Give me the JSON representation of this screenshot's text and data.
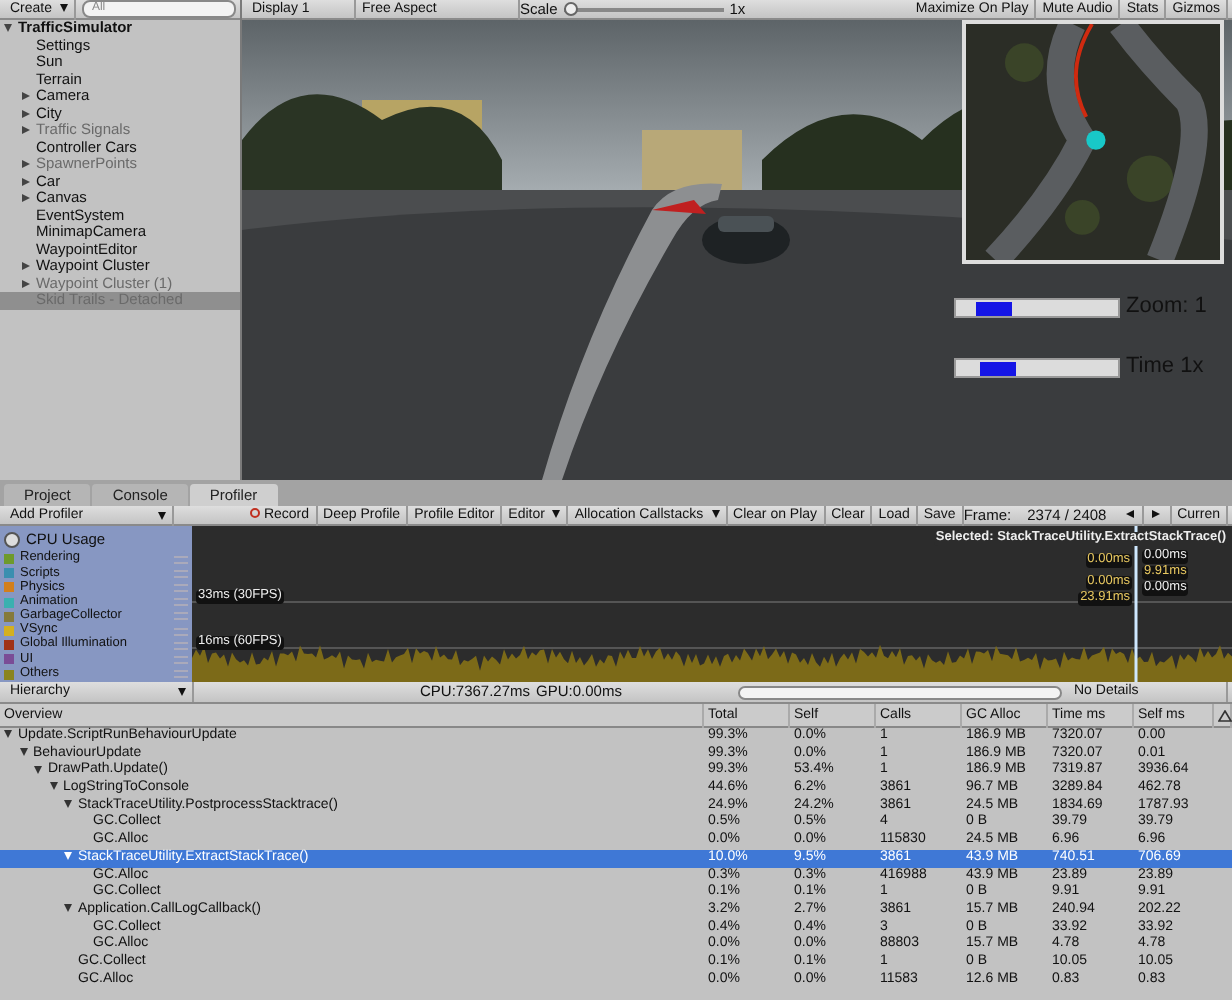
{
  "hierarchy_panel": {
    "create_button": "Create",
    "search": {
      "placeholder": "All"
    },
    "root": {
      "label": "TrafficSimulator",
      "expanded": true,
      "selected": false,
      "disabled": false,
      "children": [
        {
          "label": "Settings",
          "kind": "leaf",
          "selected": false,
          "disabled": false
        },
        {
          "label": "Sun",
          "kind": "leaf",
          "selected": false,
          "disabled": false
        },
        {
          "label": "Terrain",
          "kind": "leaf",
          "selected": false,
          "disabled": false
        },
        {
          "label": "Camera",
          "kind": "group",
          "expanded": false,
          "selected": false,
          "disabled": false
        },
        {
          "label": "City",
          "kind": "group",
          "expanded": false,
          "selected": false,
          "disabled": false
        },
        {
          "label": "Traffic Signals",
          "kind": "group",
          "expanded": false,
          "selected": false,
          "disabled": true
        },
        {
          "label": "Controller Cars",
          "kind": "leaf",
          "selected": false,
          "disabled": false
        },
        {
          "label": "SpawnerPoints",
          "kind": "group",
          "expanded": false,
          "selected": false,
          "disabled": true
        },
        {
          "label": "Car",
          "kind": "group",
          "expanded": false,
          "selected": false,
          "disabled": false
        },
        {
          "label": "Canvas",
          "kind": "group",
          "expanded": false,
          "selected": false,
          "disabled": false
        },
        {
          "label": "EventSystem",
          "kind": "leaf",
          "selected": false,
          "disabled": false
        },
        {
          "label": "MinimapCamera",
          "kind": "leaf",
          "selected": false,
          "disabled": false
        },
        {
          "label": "WaypointEditor",
          "kind": "leaf",
          "selected": false,
          "disabled": false
        },
        {
          "label": "Waypoint Cluster",
          "kind": "group",
          "expanded": false,
          "selected": false,
          "disabled": false
        },
        {
          "label": "Waypoint Cluster (1)",
          "kind": "group",
          "expanded": false,
          "selected": false,
          "disabled": true
        },
        {
          "label": "Skid Trails - Detached",
          "kind": "leaf",
          "selected": true,
          "disabled": true
        }
      ]
    }
  },
  "game_view": {
    "toolbar": {
      "display": "Display 1",
      "aspect": "Free Aspect",
      "scale_label": "Scale",
      "scale_value": "1x",
      "buttons": [
        "Maximize On Play",
        "Mute Audio",
        "Stats",
        "Gizmos"
      ]
    },
    "sliders": [
      {
        "label": "Zoom: 1",
        "level": 0.12
      },
      {
        "label": "Time 1x",
        "level": 0.14
      }
    ]
  },
  "profiler": {
    "tabs": [
      {
        "label": "Project",
        "selected": false
      },
      {
        "label": "Console",
        "selected": false
      },
      {
        "label": "Profiler",
        "selected": true
      }
    ],
    "toolbar": {
      "add_profiler": "Add Profiler",
      "record": "Record",
      "buttons_left": [
        "Deep Profile",
        "Profile Editor"
      ],
      "dropdowns": [
        "Editor",
        "Allocation Callstacks"
      ],
      "buttons_right": [
        "Clear on Play",
        "Clear",
        "Load",
        "Save"
      ],
      "frame_label": "Frame:",
      "frame_value": "2374 / 2408",
      "current": "Curren"
    },
    "legend_title": "CPU Usage",
    "legend": [
      {
        "name": "Rendering",
        "color": "#6e9a2c"
      },
      {
        "name": "Scripts",
        "color": "#3a8fb0"
      },
      {
        "name": "Physics",
        "color": "#d27f1c"
      },
      {
        "name": "Animation",
        "color": "#3ab0b0"
      },
      {
        "name": "GarbageCollector",
        "color": "#857a3c"
      },
      {
        "name": "VSync",
        "color": "#d4b020"
      },
      {
        "name": "Global Illumination",
        "color": "#a03218"
      },
      {
        "name": "UI",
        "color": "#7a4c96"
      },
      {
        "name": "Others",
        "color": "#8a8420"
      }
    ],
    "chart_lines": [
      "33ms (30FPS)",
      "16ms (60FPS)"
    ],
    "selected_label": "Selected: StackTraceUtility.ExtractStackTrace()",
    "readings_left": [
      "0.00ms",
      "0.00ms",
      "23.91ms"
    ],
    "readings_right": [
      "0.00ms",
      "9.91ms",
      "0.00ms"
    ],
    "details_bar": {
      "view": "Hierarchy",
      "cpu": "CPU:7367.27ms",
      "gpu": "GPU:0.00ms",
      "details": "No Details"
    },
    "table": {
      "columns": [
        "Overview",
        "Total",
        "Self",
        "Calls",
        "GC Alloc",
        "Time ms",
        "Self ms"
      ],
      "rows": [
        {
          "name": "Update.ScriptRunBehaviourUpdate",
          "total": "99.3%",
          "self": "0.0%",
          "calls": "1",
          "gc_alloc": "186.9 MB",
          "time_ms": "7320.07",
          "self_ms": "0.00",
          "selected": false,
          "expanded": true,
          "children": [
            {
              "name": "BehaviourUpdate",
              "total": "99.3%",
              "self": "0.0%",
              "calls": "1",
              "gc_alloc": "186.9 MB",
              "time_ms": "7320.07",
              "self_ms": "0.01",
              "selected": false,
              "expanded": true,
              "children": [
                {
                  "name": "DrawPath.Update()",
                  "total": "99.3%",
                  "self": "53.4%",
                  "calls": "1",
                  "gc_alloc": "186.9 MB",
                  "time_ms": "7319.87",
                  "self_ms": "3936.64",
                  "selected": false,
                  "expanded": true,
                  "children": [
                    {
                      "name": "LogStringToConsole",
                      "total": "44.6%",
                      "self": "6.2%",
                      "calls": "3861",
                      "gc_alloc": "96.7 MB",
                      "time_ms": "3289.84",
                      "self_ms": "462.78",
                      "selected": false,
                      "expanded": true,
                      "children": [
                        {
                          "name": "StackTraceUtility.PostprocessStacktrace()",
                          "total": "24.9%",
                          "self": "24.2%",
                          "calls": "3861",
                          "gc_alloc": "24.5 MB",
                          "time_ms": "1834.69",
                          "self_ms": "1787.93",
                          "selected": false,
                          "expanded": true,
                          "children": [
                            {
                              "name": "GC.Collect",
                              "total": "0.5%",
                              "self": "0.5%",
                              "calls": "4",
                              "gc_alloc": "0 B",
                              "time_ms": "39.79",
                              "self_ms": "39.79",
                              "selected": false
                            },
                            {
                              "name": "GC.Alloc",
                              "total": "0.0%",
                              "self": "0.0%",
                              "calls": "115830",
                              "gc_alloc": "24.5 MB",
                              "time_ms": "6.96",
                              "self_ms": "6.96",
                              "selected": false
                            }
                          ]
                        },
                        {
                          "name": "StackTraceUtility.ExtractStackTrace()",
                          "total": "10.0%",
                          "self": "9.5%",
                          "calls": "3861",
                          "gc_alloc": "43.9 MB",
                          "time_ms": "740.51",
                          "self_ms": "706.69",
                          "selected": true,
                          "expanded": true,
                          "children": [
                            {
                              "name": "GC.Alloc",
                              "total": "0.3%",
                              "self": "0.3%",
                              "calls": "416988",
                              "gc_alloc": "43.9 MB",
                              "time_ms": "23.89",
                              "self_ms": "23.89",
                              "selected": false
                            },
                            {
                              "name": "GC.Collect",
                              "total": "0.1%",
                              "self": "0.1%",
                              "calls": "1",
                              "gc_alloc": "0 B",
                              "time_ms": "9.91",
                              "self_ms": "9.91",
                              "selected": false
                            }
                          ]
                        },
                        {
                          "name": "Application.CallLogCallback()",
                          "total": "3.2%",
                          "self": "2.7%",
                          "calls": "3861",
                          "gc_alloc": "15.7 MB",
                          "time_ms": "240.94",
                          "self_ms": "202.22",
                          "selected": false,
                          "expanded": true,
                          "children": [
                            {
                              "name": "GC.Collect",
                              "total": "0.4%",
                              "self": "0.4%",
                              "calls": "3",
                              "gc_alloc": "0 B",
                              "time_ms": "33.92",
                              "self_ms": "33.92",
                              "selected": false
                            },
                            {
                              "name": "GC.Alloc",
                              "total": "0.0%",
                              "self": "0.0%",
                              "calls": "88803",
                              "gc_alloc": "15.7 MB",
                              "time_ms": "4.78",
                              "self_ms": "4.78",
                              "selected": false
                            }
                          ]
                        },
                        {
                          "name": "GC.Collect",
                          "total": "0.1%",
                          "self": "0.1%",
                          "calls": "1",
                          "gc_alloc": "0 B",
                          "time_ms": "10.05",
                          "self_ms": "10.05",
                          "selected": false
                        },
                        {
                          "name": "GC.Alloc",
                          "total": "0.0%",
                          "self": "0.0%",
                          "calls": "11583",
                          "gc_alloc": "12.6 MB",
                          "time_ms": "0.83",
                          "self_ms": "0.83",
                          "selected": false
                        }
                      ]
                    }
                  ]
                }
              ]
            }
          ]
        }
      ]
    }
  }
}
